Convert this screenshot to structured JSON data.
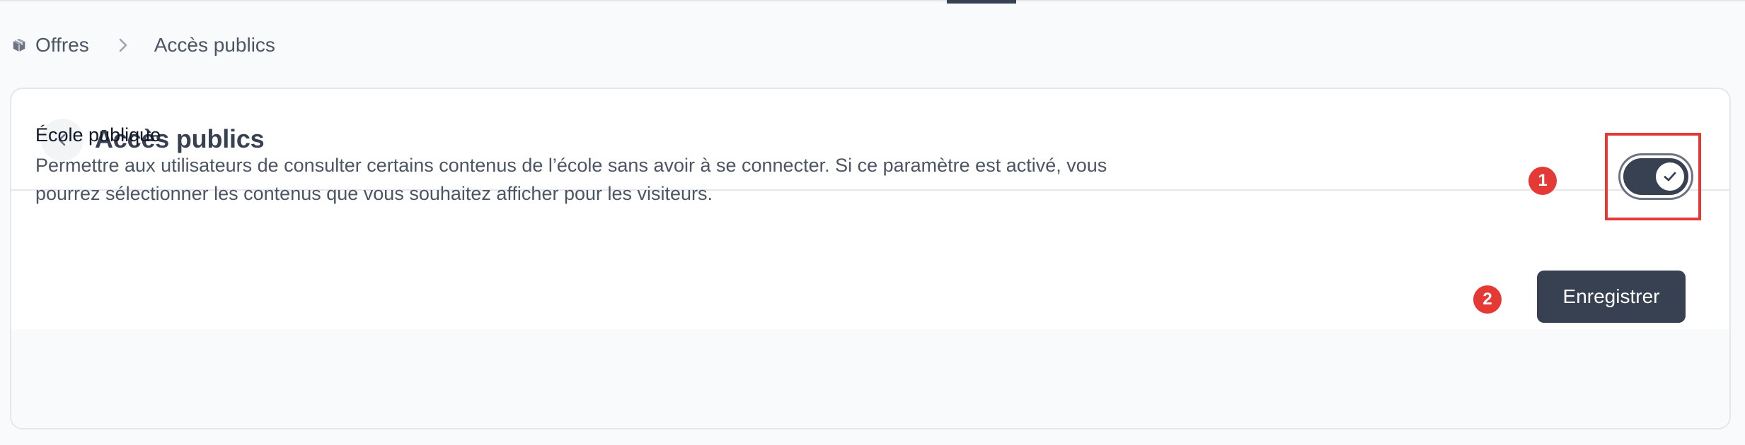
{
  "breadcrumb": {
    "home_icon": "cube-icon",
    "home_label": "Offres",
    "separator_icon": "chevron-right-icon",
    "current_label": "Accès publics"
  },
  "card": {
    "back_icon": "chevron-left-icon",
    "title": "Accès publics"
  },
  "setting": {
    "title": "École publique",
    "description": "Permettre aux utilisateurs de consulter certains contenus de l’école sans avoir à se connecter. Si ce paramètre est activé, vous pourrez sélectionner les contenus que vous souhaitez afficher pour les visiteurs.",
    "toggle_checked": true,
    "toggle_icon": "check-icon"
  },
  "annotations": {
    "badge_1": "1",
    "badge_2": "2"
  },
  "footer": {
    "save_label": "Enregistrer"
  },
  "colors": {
    "primary": "#374151",
    "annotation_red": "#e53935",
    "background": "#f9fafb"
  }
}
